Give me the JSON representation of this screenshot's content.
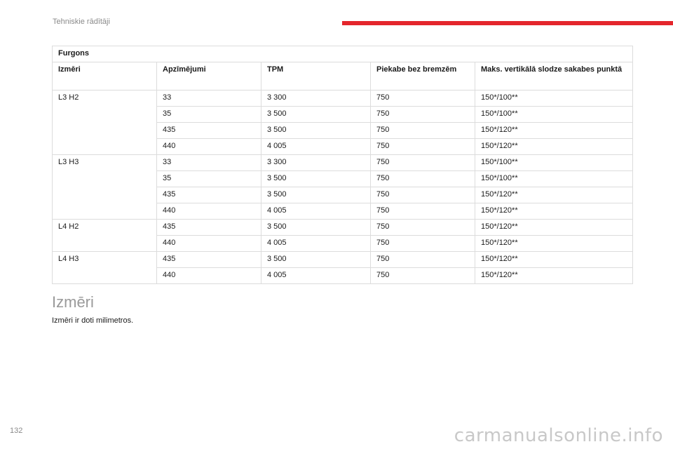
{
  "header": {
    "title": "Tehniskie rādītāji"
  },
  "table": {
    "title": "Furgons",
    "columns": [
      "Izmēri",
      "Apzīmējumi",
      "TPM",
      "Piekabe bez bremzēm",
      "Maks. vertikālā slodze sakabes punktā"
    ],
    "groups": [
      {
        "dimension": "L3 H2",
        "rows": [
          [
            "33",
            "3 300",
            "750",
            "150*/100**"
          ],
          [
            "35",
            "3 500",
            "750",
            "150*/100**"
          ],
          [
            "435",
            "3 500",
            "750",
            "150*/120**"
          ],
          [
            "440",
            "4 005",
            "750",
            "150*/120**"
          ]
        ]
      },
      {
        "dimension": "L3 H3",
        "rows": [
          [
            "33",
            "3 300",
            "750",
            "150*/100**"
          ],
          [
            "35",
            "3 500",
            "750",
            "150*/100**"
          ],
          [
            "435",
            "3 500",
            "750",
            "150*/120**"
          ],
          [
            "440",
            "4 005",
            "750",
            "150*/120**"
          ]
        ]
      },
      {
        "dimension": "L4 H2",
        "rows": [
          [
            "435",
            "3 500",
            "750",
            "150*/120**"
          ],
          [
            "440",
            "4 005",
            "750",
            "150*/120**"
          ]
        ]
      },
      {
        "dimension": "L4 H3",
        "rows": [
          [
            "435",
            "3 500",
            "750",
            "150*/120**"
          ],
          [
            "440",
            "4 005",
            "750",
            "150*/120**"
          ]
        ]
      }
    ]
  },
  "section": {
    "heading": "Izmēri",
    "text": "Izmēri ir doti milimetros."
  },
  "footer": {
    "page_number": "132",
    "watermark": "carmanualsonline.info"
  },
  "colors": {
    "accent": "#e4262c",
    "muted": "#8a8a8a"
  }
}
